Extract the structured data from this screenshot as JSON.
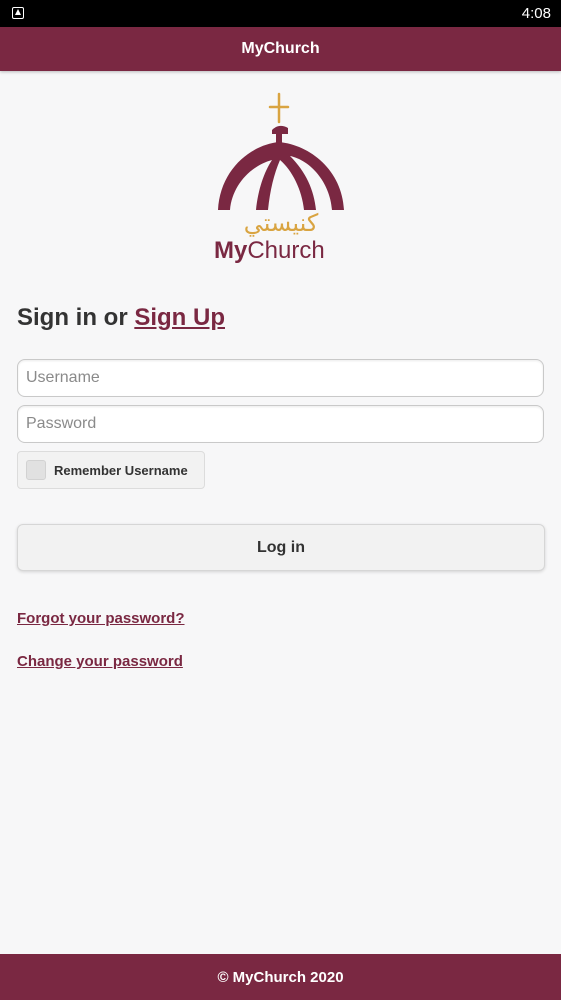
{
  "status_bar": {
    "time": "4:08"
  },
  "header": {
    "title": "MyChurch"
  },
  "logo": {
    "wordmark_a": "My",
    "wordmark_b": "Church",
    "arabic": "كنيستي"
  },
  "signin": {
    "prefix": "Sign in or ",
    "signup_link": "Sign Up"
  },
  "form": {
    "username": {
      "value": "",
      "placeholder": "Username"
    },
    "password": {
      "value": "",
      "placeholder": "Password"
    },
    "remember_label": "Remember Username",
    "remember_checked": false,
    "login_label": "Log in"
  },
  "links": {
    "forgot": "Forgot your password?",
    "change": "Change your password"
  },
  "footer": {
    "text": "© MyChurch 2020"
  },
  "colors": {
    "brand": "#7a2842",
    "accent_gold": "#d9a441",
    "background": "#f7f7f8"
  }
}
